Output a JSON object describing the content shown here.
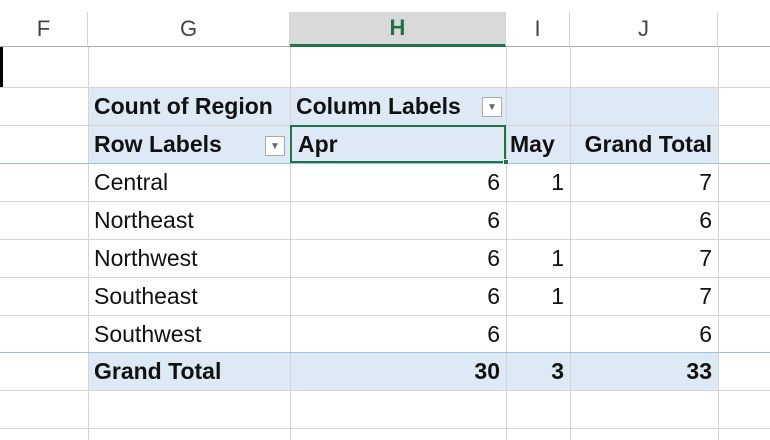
{
  "columns": [
    "F",
    "G",
    "H",
    "I",
    "J"
  ],
  "pivot": {
    "value_field": "Count of Region",
    "column_labels": "Column Labels",
    "row_labels": "Row Labels",
    "col_headers": [
      "Apr",
      "May",
      "Grand Total"
    ],
    "rows": [
      {
        "label": "Central",
        "apr": "6",
        "may": "1",
        "total": "7"
      },
      {
        "label": "Northeast",
        "apr": "6",
        "may": "",
        "total": "6"
      },
      {
        "label": "Northwest",
        "apr": "6",
        "may": "1",
        "total": "7"
      },
      {
        "label": "Southeast",
        "apr": "6",
        "may": "1",
        "total": "7"
      },
      {
        "label": "Southwest",
        "apr": "6",
        "may": "",
        "total": "6"
      }
    ],
    "grand_total": {
      "label": "Grand Total",
      "apr": "30",
      "may": "3",
      "total": "33"
    }
  },
  "icons": {
    "filter_dropdown": "chevron-down-icon"
  }
}
